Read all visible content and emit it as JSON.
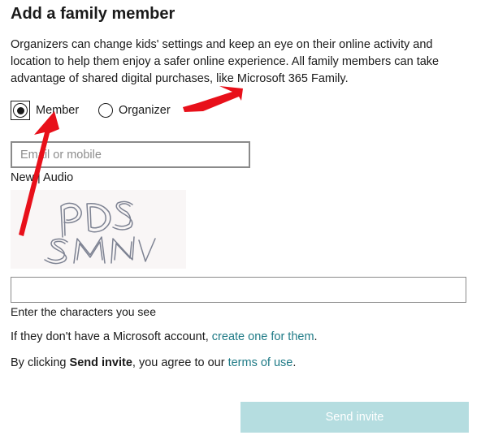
{
  "dialog": {
    "title": "Add a family member",
    "description": "Organizers can change kids' settings and keep an eye on their online activity and location to help them enjoy a safer online experience. All family members can take advantage of shared digital purchases, like Microsoft 365 Family."
  },
  "role": {
    "selected": "Member",
    "options": [
      {
        "label": "Member",
        "selected": true
      },
      {
        "label": "Organizer",
        "selected": false
      }
    ]
  },
  "email": {
    "placeholder": "Email or mobile",
    "value": ""
  },
  "captcha": {
    "new_label": "New",
    "separator": " | ",
    "audio_label": "Audio",
    "image_text": "PDSMN",
    "input_value": "",
    "hint": "Enter the characters you see"
  },
  "no_account": {
    "text": "If they don't have a Microsoft account, ",
    "link": "create one for them",
    "suffix": "."
  },
  "terms": {
    "prefix": "By clicking ",
    "bold": "Send invite",
    "middle": ", you agree to our ",
    "link": "terms of use",
    "suffix": "."
  },
  "send_button": {
    "label": "Send invite",
    "enabled": false
  },
  "colors": {
    "link": "#1e7a86",
    "button_disabled_bg": "#b5dde0",
    "annotation_arrow": "#e8101a"
  }
}
